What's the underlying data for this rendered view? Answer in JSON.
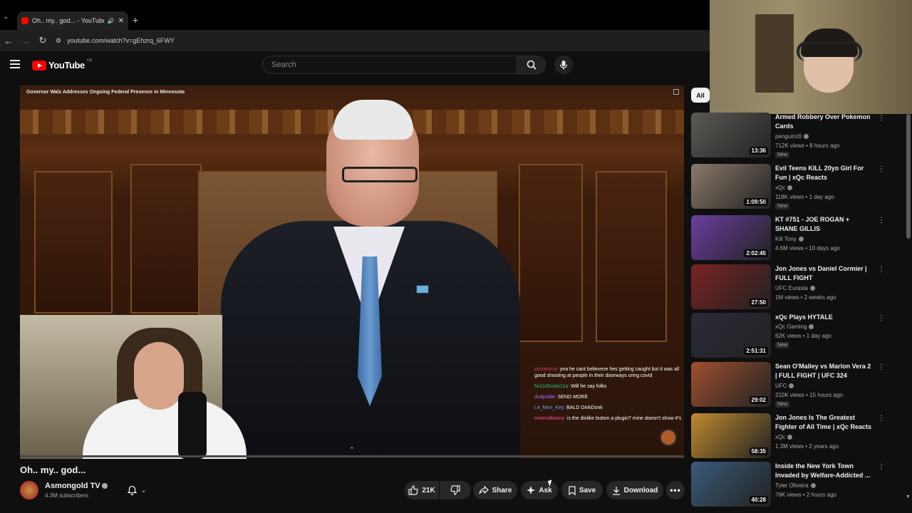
{
  "browser": {
    "tab_title": "Oh.. my.. god... - YouTube",
    "new_tab": "+",
    "url": "youtube.com/watch?v=gEhzrq_6FWY"
  },
  "yt": {
    "logo_text": "YouTube",
    "country": "CA",
    "search_placeholder": "Search"
  },
  "video": {
    "overlay_title": "Governor Walz Addresses Ongoing Federal Presence in Minnesota",
    "chat": [
      {
        "user": "pizzamma:",
        "text": "yea he cant believeve hes getting caught but it was all good shooting at people in their doorways uring covid"
      },
      {
        "user": "Ni11aGodzi11a:",
        "text": "Will he say folks"
      },
      {
        "user": "dudpolde:",
        "text": "SEND MORE"
      },
      {
        "user": "Le_Mon_Key:",
        "text": "BALD DinkDonk"
      },
      {
        "user": "mineralbunny:",
        "text": "is the dislike button a plugin? mine doesn't show #'s"
      }
    ]
  },
  "meta": {
    "title": "Oh.. my.. god...",
    "channel": "Asmongold TV",
    "subscribers": "4.3M subscribers",
    "likes": "21K",
    "share": "Share",
    "ask": "Ask",
    "save": "Save",
    "download": "Download"
  },
  "sidebar": {
    "chip": "All",
    "recs": [
      {
        "title": "Armed Robbery Over Pokemon Cards",
        "channel": "penguinz0",
        "meta": "712K views • 8 hours ago",
        "badge": "New",
        "duration": "13:36",
        "color": "#5c5a55"
      },
      {
        "title": "Evil Teens KILL 20yo Girl For Fun | xQc Reacts",
        "channel": "xQc",
        "meta": "118K views • 1 day ago",
        "badge": "New",
        "duration": "1:09:50",
        "color": "#8a7a6a"
      },
      {
        "title": "KT #751 - JOE ROGAN + SHANE GILLIS",
        "channel": "Kill Tony",
        "meta": "4.6M views • 10 days ago",
        "badge": "",
        "duration": "2:02:45",
        "color": "#6a3fa0"
      },
      {
        "title": "Jon Jones vs Daniel Cormier | FULL FIGHT",
        "channel": "UFC Eurasia",
        "meta": "1M views • 2 weeks ago",
        "badge": "",
        "duration": "27:50",
        "color": "#7a2222"
      },
      {
        "title": "xQc Plays HYTALE",
        "channel": "xQc Gaming",
        "meta": "62K views • 1 day ago",
        "badge": "New",
        "duration": "2:51:31",
        "color": "#2a2a3a"
      },
      {
        "title": "Sean O'Malley vs Marlon Vera 2 | FULL FIGHT | UFC 324",
        "channel": "UFC",
        "meta": "210K views • 15 hours ago",
        "badge": "New",
        "duration": "29:02",
        "color": "#a05030"
      },
      {
        "title": "Jon Jones Is The Greatest Fighter of All Time | xQc Reacts",
        "channel": "xQc",
        "meta": "1.3M views • 2 years ago",
        "badge": "",
        "duration": "58:35",
        "color": "#c08a30"
      },
      {
        "title": "Inside the New York Town Invaded by Welfare-Addicted ...",
        "channel": "Tyler Oliveira",
        "meta": "76K views • 2 hours ago",
        "badge": "",
        "duration": "40:28",
        "color": "#3a5a7a"
      }
    ]
  }
}
